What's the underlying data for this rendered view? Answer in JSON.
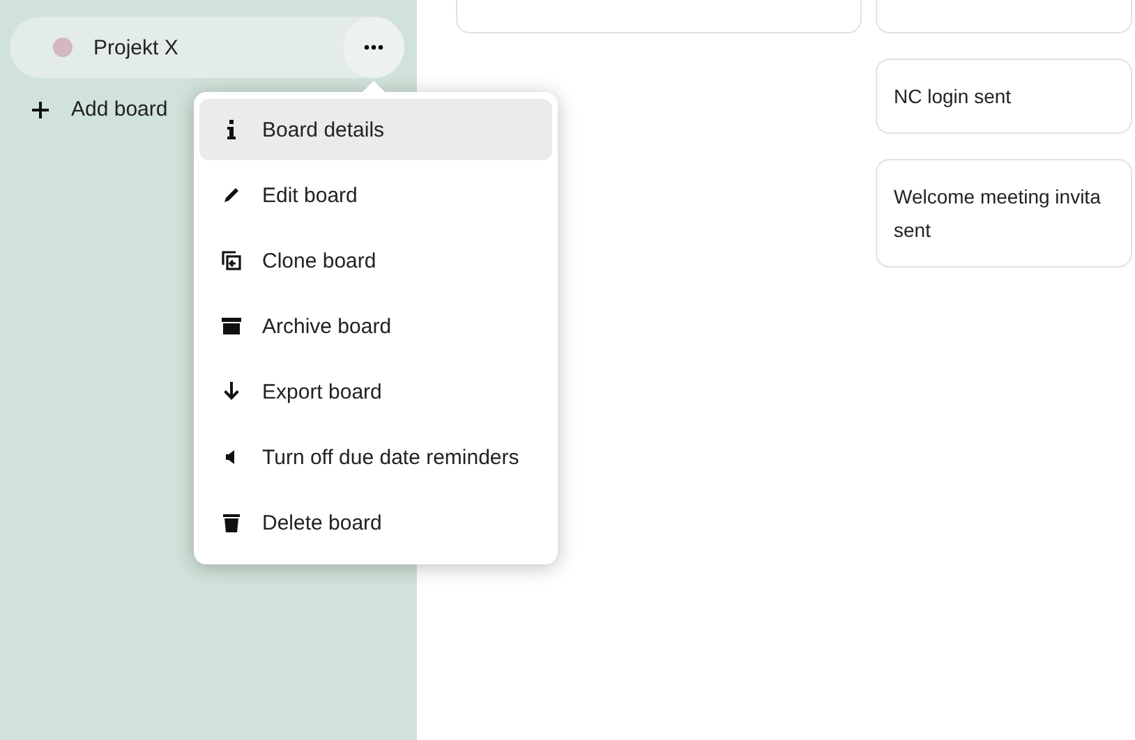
{
  "sidebar": {
    "boards": [
      {
        "name": "Projekt X",
        "color": "#d4b8c0",
        "selected": true
      }
    ],
    "add_board": "Add board"
  },
  "board_menu": {
    "items": [
      {
        "label": "Board details",
        "selected": true
      },
      {
        "label": "Edit board",
        "selected": false
      },
      {
        "label": "Clone board",
        "selected": false
      },
      {
        "label": "Archive board",
        "selected": false
      },
      {
        "label": "Export board",
        "selected": false
      },
      {
        "label": "Turn off due date reminders",
        "selected": false
      },
      {
        "label": "Delete board",
        "selected": false
      }
    ]
  },
  "cards": [
    {
      "lines": [
        "NC login sent"
      ]
    },
    {
      "lines": [
        "Welcome meeting invita",
        "sent"
      ]
    }
  ]
}
